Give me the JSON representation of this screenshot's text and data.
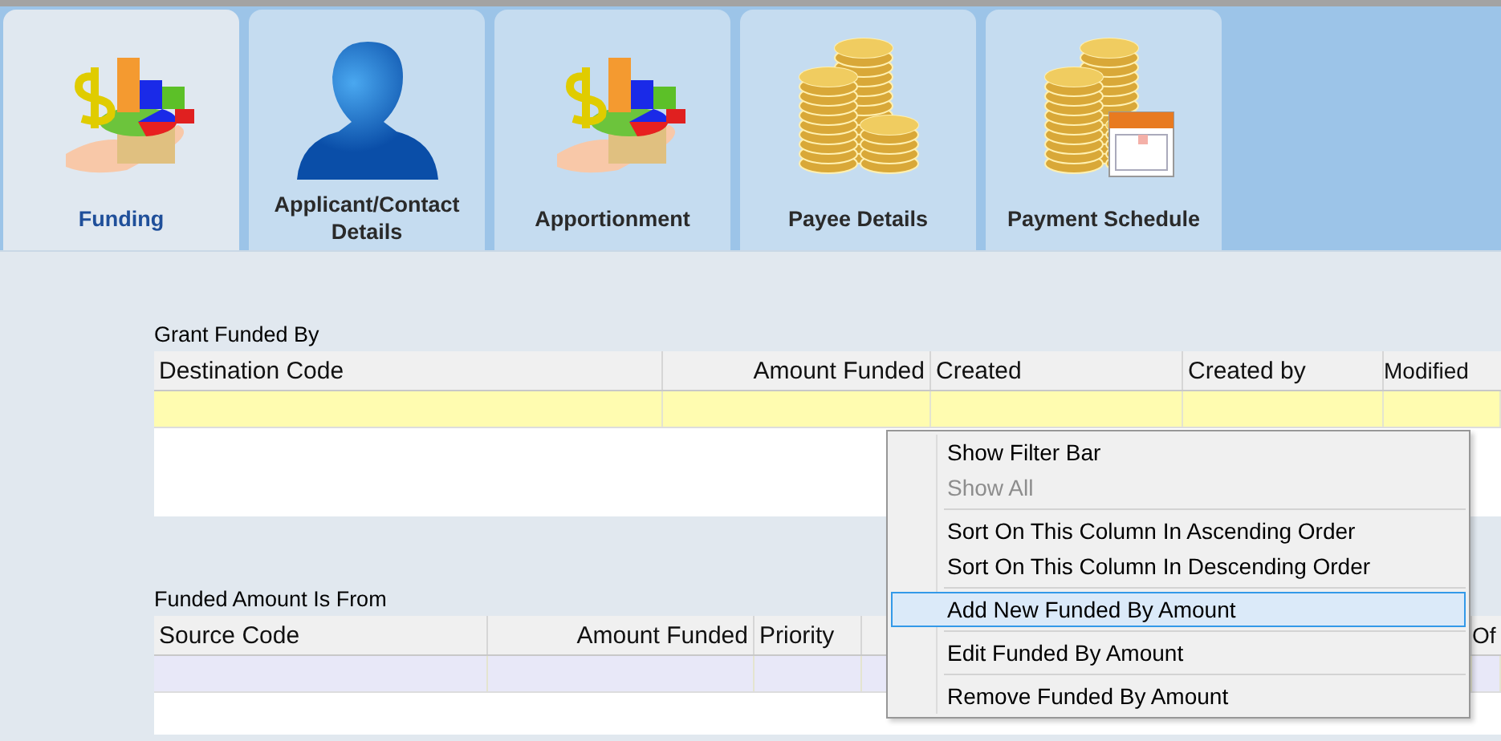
{
  "tabs": [
    {
      "label": "Funding",
      "selected": true,
      "kind": "grant"
    },
    {
      "label": "Applicant/Contact Details",
      "selected": false,
      "kind": "person"
    },
    {
      "label": "Apportionment",
      "selected": false,
      "kind": "grant"
    },
    {
      "label": "Payee Details",
      "selected": false,
      "kind": "coins"
    },
    {
      "label": "Payment Schedule",
      "selected": false,
      "kind": "schedule"
    }
  ],
  "grant_funded_by": {
    "title": "Grant Funded By",
    "columns": [
      {
        "label": "Destination Code"
      },
      {
        "label": "Amount Funded"
      },
      {
        "label": "Created"
      },
      {
        "label": "Created by"
      },
      {
        "label": "Modified"
      }
    ]
  },
  "funded_amount_is_from": {
    "title": "Funded Amount Is From",
    "columns": [
      {
        "label": "Source Code"
      },
      {
        "label": "Amount Funded"
      },
      {
        "label": "Priority"
      },
      {
        "label": "Of"
      }
    ]
  },
  "context_menu": {
    "items": [
      {
        "kind": "item",
        "label": "Show Filter Bar",
        "disabled": false,
        "selected": false
      },
      {
        "kind": "item",
        "label": "Show All",
        "disabled": true,
        "selected": false
      },
      {
        "kind": "separator"
      },
      {
        "kind": "item",
        "label": "Sort On This Column In Ascending Order",
        "disabled": false,
        "selected": false
      },
      {
        "kind": "item",
        "label": "Sort On This Column In Descending Order",
        "disabled": false,
        "selected": false
      },
      {
        "kind": "separator"
      },
      {
        "kind": "item",
        "label": "Add New Funded By Amount",
        "disabled": false,
        "selected": true
      },
      {
        "kind": "separator"
      },
      {
        "kind": "item",
        "label": "Edit Funded By Amount",
        "disabled": false,
        "selected": false
      },
      {
        "kind": "separator"
      },
      {
        "kind": "item",
        "label": "Remove Funded By Amount",
        "disabled": false,
        "selected": false
      }
    ]
  }
}
